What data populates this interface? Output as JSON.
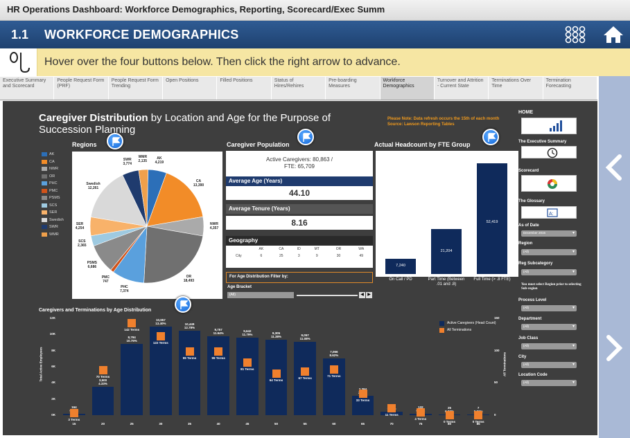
{
  "window_title": "HR Operations Dashboard: Workforce Demographics, Reporting, Scorecard/Exec Summ",
  "header": {
    "number": "1.1",
    "title": "WORKFORCE DEMOGRAPHICS"
  },
  "instruction": "Hover over the four buttons below. Then click the right arrow to advance.",
  "tabs": [
    {
      "label": "Executive Summary and Scorecard"
    },
    {
      "label": "People Request Form (PRF)"
    },
    {
      "label": "People Request Form Trending"
    },
    {
      "label": "Open Positions"
    },
    {
      "label": "Filled Positions"
    },
    {
      "label": "Status of Hires/Rehires"
    },
    {
      "label": "Pre-boarding Measures"
    },
    {
      "label": "Workforce Demographics"
    },
    {
      "label": "Turnover and Attrition - Current State"
    },
    {
      "label": "Terminations Over Time"
    },
    {
      "label": "Termination Forecasting"
    }
  ],
  "dashboard": {
    "title_bold": "Caregiver Distribution",
    "title_rest": " by Location and Age for the Purpose of Succession Planning",
    "note_line1": "Please Note: Data refresh occurs the 15th of each month",
    "note_line2": "Source: Lawson Reporting Tables",
    "regions_title": "Regions",
    "population_title": "Caregiver Population",
    "active_caregivers": "Active Caregivers: 80,863 /",
    "fte": "FTE: 65,709",
    "avg_age_label": "Average Age (Years)",
    "avg_age": "44.10",
    "avg_tenure_label": "Average Tenure (Years)",
    "avg_tenure": "8.16",
    "geography_title": "Geography",
    "geo_headers": [
      "",
      "AK",
      "CA",
      "ID",
      "MT",
      "OR",
      "WA"
    ],
    "geo_row": [
      "City",
      "6",
      "25",
      "3",
      "9",
      "30",
      "49"
    ],
    "age_filter_label": "For Age Distribution Filter by:",
    "age_bracket_label": "Age Bracket",
    "age_bracket_value": "(All)",
    "fte_title": "Actual Headcount by FTE Group",
    "bottom_title": "Caregivers and Terminations by Age Distribution"
  },
  "right_panel": {
    "home": "HOME",
    "exec_summary": "The Executive Summary",
    "scorecard": "Scorecard",
    "glossary": "The Glossary",
    "as_of_date_label": "As of Date",
    "as_of_date_value": "December 2015",
    "region_label": "Region",
    "region_value": "(All)",
    "reg_sub_label": "Reg Subcategory",
    "reg_sub_value": "(All)",
    "warning": "You must select Region prior to selecting Sub-region",
    "process_level_label": "Process Level",
    "process_level_value": "(All)",
    "department_label": "Department",
    "department_value": "(All)",
    "job_class_label": "Job Class",
    "job_class_value": "(All)",
    "city_label": "City",
    "city_value": "(All)",
    "location_code_label": "Location Code",
    "location_code_value": "(All)"
  },
  "chart_data": [
    {
      "type": "pie",
      "title": "Regions",
      "categories": [
        "AK",
        "CA",
        "NWR",
        "OR",
        "PHC",
        "PMC",
        "PSMS",
        "SCS",
        "SER",
        "Swedish",
        "SWR",
        "WMR"
      ],
      "values": [
        4219,
        13390,
        4357,
        18493,
        7374,
        747,
        6686,
        2365,
        4254,
        12261,
        3774,
        2135
      ],
      "colors": [
        "#2c6fb8",
        "#f28c28",
        "#aaaaaa",
        "#707070",
        "#5aa0dd",
        "#d1531a",
        "#8a8a8a",
        "#9ecae1",
        "#f8b26a",
        "#d9d9d9",
        "#1f3b6e",
        "#f0a04b"
      ],
      "labels": [
        {
          "name": "AK",
          "value": "4,219"
        },
        {
          "name": "CA",
          "value": "13,390"
        },
        {
          "name": "NWR",
          "value": "4,357"
        },
        {
          "name": "OR",
          "value": "18,493"
        },
        {
          "name": "PHC",
          "value": "7,374"
        },
        {
          "name": "PMC",
          "value": "747"
        },
        {
          "name": "PSMS",
          "value": "6,686"
        },
        {
          "name": "SCS",
          "value": "2,365"
        },
        {
          "name": "SER",
          "value": "4,254"
        },
        {
          "name": "Swedish",
          "value": "12,261"
        },
        {
          "name": "SWR",
          "value": "3,774"
        },
        {
          "name": "WMR",
          "value": "2,135"
        }
      ]
    },
    {
      "type": "bar",
      "title": "Actual Headcount by FTE Group",
      "categories": [
        "On Call / PD",
        "Part Time (Between .01 and .8)",
        "Full Time (> .8 FTE)"
      ],
      "values": [
        7240,
        21204,
        52419
      ],
      "labels": [
        "7,240",
        "21,204",
        "52,419"
      ]
    },
    {
      "type": "bar",
      "title": "Caregivers and Terminations by Age Distribution",
      "x": [
        "15",
        "20",
        "25",
        "30",
        "35",
        "40",
        "45",
        "50",
        "55",
        "60",
        "65",
        "70",
        "75",
        "80",
        "85"
      ],
      "series": [
        {
          "name": "Active Caregivers (Head Count)",
          "values": [
            164,
            3500,
            8794,
            10957,
            10449,
            9757,
            9642,
            9305,
            9057,
            7066,
            2394,
            443,
            132,
            25,
            7
          ],
          "labels": [
            "164\n0.20%",
            "3,500\n4.33%",
            "8,794\n10.75%",
            "10,957\n13.40%",
            "10,449\n12.78%",
            "9,757\n11.94%",
            "9,642\n11.79%",
            "9,305\n11.38%",
            "9,057\n11.08%",
            "7,066\n8.62%",
            "2,394\n2.95%",
            "443\n0.55%",
            "132\n0.17%",
            "25\n0.03%",
            "7\n0.01%"
          ]
        },
        {
          "name": "All Terminations",
          "values": [
            3,
            70,
            142,
            122,
            99,
            99,
            81,
            64,
            67,
            71,
            33,
            11,
            4,
            0,
            0
          ],
          "labels": [
            "3 Terms",
            "70 Terms",
            "142 Terms",
            "122 Terms",
            "99 Terms",
            "99 Terms",
            "81 Terms",
            "64 Terms",
            "67 Terms",
            "71 Terms",
            "33 Terms",
            "11 Terms",
            "4 Terms",
            "0 Terms",
            "0 Terms"
          ]
        }
      ],
      "ylabel": "Total Active Employees",
      "y2label": "All Terminations",
      "ylim": [
        0,
        12000
      ],
      "y2lim": [
        0,
        150
      ],
      "yticks": [
        "0K",
        "2K",
        "4K",
        "6K",
        "8K",
        "10K",
        "12K"
      ],
      "y2ticks": [
        "0",
        "50",
        "100",
        "150"
      ],
      "legend": "top-right"
    }
  ]
}
